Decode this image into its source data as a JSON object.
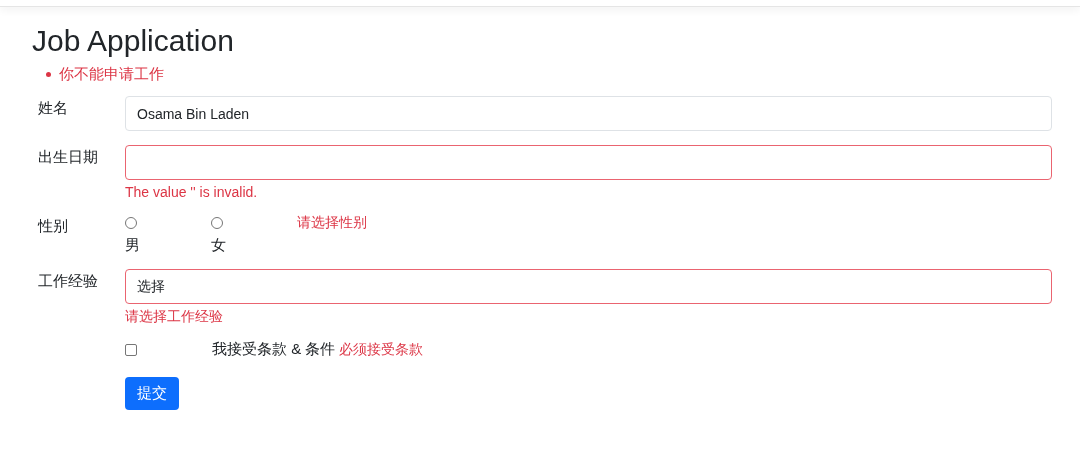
{
  "title": "Job Application",
  "errors": [
    "你不能申请工作"
  ],
  "fields": [
    {
      "kind": "text",
      "label": "姓名",
      "value": "Osama Bin Laden",
      "invalid": false
    },
    {
      "kind": "text",
      "label": "出生日期",
      "invalid": true,
      "error": "The value '' is invalid."
    },
    {
      "kind": "radio",
      "label": "性别",
      "options": [
        {
          "label": "男",
          "selected": false
        },
        {
          "label": "女",
          "selected": false
        }
      ],
      "error": "请选择性别"
    },
    {
      "kind": "select",
      "label": "工作经验",
      "value": "选择",
      "invalid": true,
      "error": "请选择工作经验"
    }
  ],
  "terms": {
    "label": "我接受条款 & 条件",
    "checked": false,
    "error": "必须接受条款"
  },
  "submit": "提交"
}
